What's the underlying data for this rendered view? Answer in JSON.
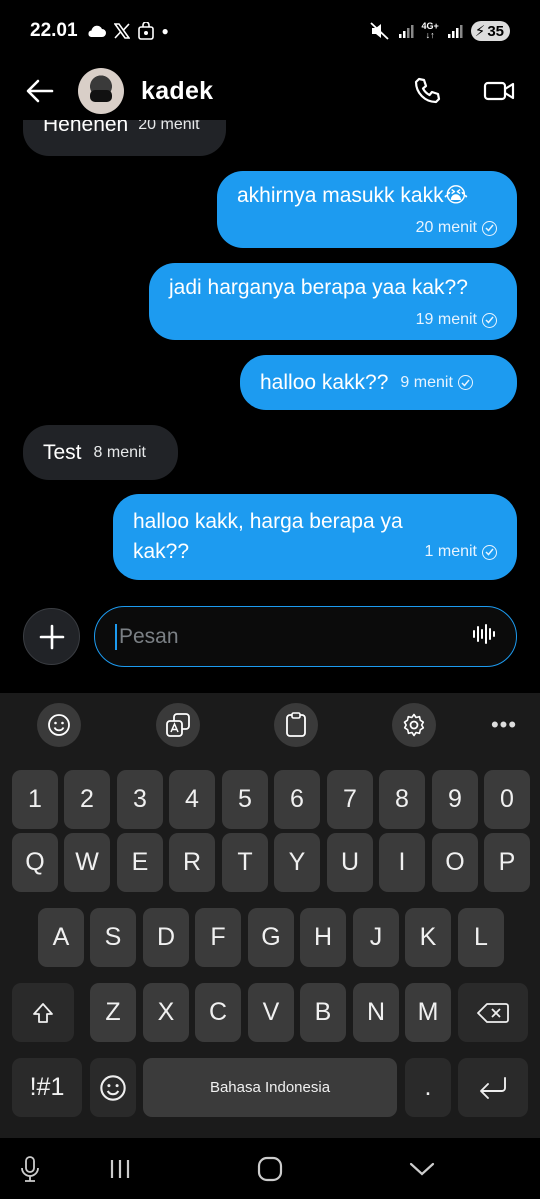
{
  "status": {
    "time": "22.01",
    "battery": "35",
    "network": "4G+"
  },
  "header": {
    "contact_name": "kadek"
  },
  "messages": {
    "partial": {
      "text": "Heheheh",
      "time": "20 menit"
    },
    "m1": {
      "text": "akhirnya masukk kakk😭",
      "time": "20 menit"
    },
    "m2": {
      "text": "jadi harganya berapa yaa kak??",
      "time": "19 menit"
    },
    "m3": {
      "text": "halloo kakk??",
      "time": "9 menit"
    },
    "m4": {
      "text": "Test",
      "time": "8 menit"
    },
    "m5": {
      "line1": "halloo kakk, harga berapa ya",
      "line2": "kak??",
      "time": "1 menit"
    }
  },
  "composer": {
    "placeholder": "Pesan"
  },
  "keyboard": {
    "row_numbers": [
      "1",
      "2",
      "3",
      "4",
      "5",
      "6",
      "7",
      "8",
      "9",
      "0"
    ],
    "row_top": [
      "Q",
      "W",
      "E",
      "R",
      "T",
      "Y",
      "U",
      "I",
      "O",
      "P"
    ],
    "row_mid": [
      "A",
      "S",
      "D",
      "F",
      "G",
      "H",
      "J",
      "K",
      "L"
    ],
    "row_bot": [
      "Z",
      "X",
      "C",
      "V",
      "B",
      "N",
      "M"
    ],
    "symbols_label": "!#1",
    "space_label": "Bahasa Indonesia",
    "period_label": "."
  },
  "colors": {
    "accent": "#1d9bf0",
    "bubble_in": "#212327",
    "keyboard_bg": "#1b1b1b"
  }
}
